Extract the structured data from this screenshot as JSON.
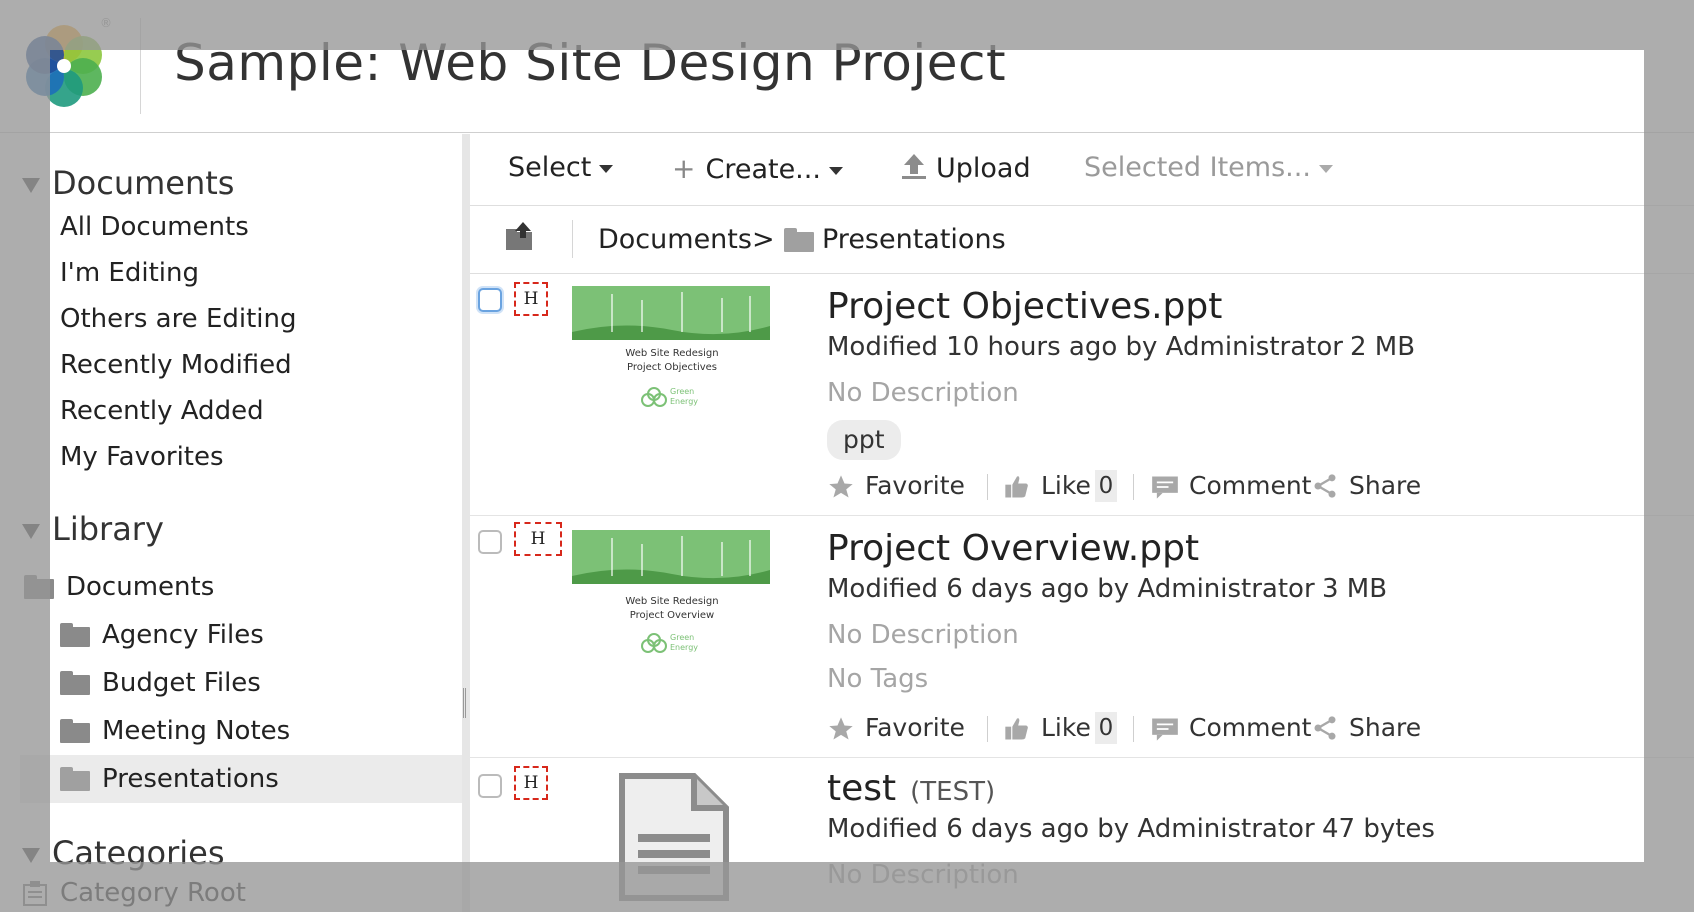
{
  "header": {
    "title": "Sample: Web Site Design Project",
    "logo": "alfresco-flower-logo"
  },
  "sidebar": {
    "documents": {
      "title": "Documents",
      "items": [
        {
          "label": "All Documents"
        },
        {
          "label": "I'm Editing"
        },
        {
          "label": "Others are Editing"
        },
        {
          "label": "Recently Modified"
        },
        {
          "label": "Recently Added"
        },
        {
          "label": "My Favorites"
        }
      ]
    },
    "library": {
      "title": "Library",
      "root": {
        "label": "Documents",
        "icon": "folder-icon"
      },
      "folders": [
        {
          "label": "Agency Files",
          "icon": "folder-icon"
        },
        {
          "label": "Budget Files",
          "icon": "folder-icon"
        },
        {
          "label": "Meeting Notes",
          "icon": "folder-icon"
        },
        {
          "label": "Presentations",
          "icon": "folder-open-icon",
          "selected": true
        }
      ]
    },
    "categories": {
      "title": "Categories",
      "root": {
        "label": "Category Root",
        "icon": "category-icon"
      }
    }
  },
  "toolbar": {
    "select_label": "Select",
    "create_label": "Create...",
    "upload_label": "Upload",
    "selected_items_label": "Selected Items..."
  },
  "breadcrumb": {
    "root": "Documents",
    "separator": ">",
    "current": "Presentations"
  },
  "documents": [
    {
      "name": "Project Objectives.ppt",
      "modified": "Modified 10 hours ago by Administrator",
      "size": "2 MB",
      "description": "No Description",
      "tags": [
        "ppt"
      ],
      "thumbnail": {
        "line1": "Web Site Redesign",
        "line2": "Project Objectives",
        "brand1": "Green",
        "brand2": "Energy"
      },
      "actions": {
        "favorite": "Favorite",
        "like": "Like",
        "like_count": "0",
        "comment": "Comment",
        "share": "Share"
      }
    },
    {
      "name": "Project Overview.ppt",
      "modified": "Modified 6 days ago by Administrator",
      "size": "3 MB",
      "description": "No Description",
      "no_tags": "No Tags",
      "thumbnail": {
        "line1": "Web Site Redesign",
        "line2": "Project Overview",
        "brand1": "Green",
        "brand2": "Energy"
      },
      "actions": {
        "favorite": "Favorite",
        "like": "Like",
        "like_count": "0",
        "comment": "Comment",
        "share": "Share"
      }
    },
    {
      "name": "test",
      "title": "(TEST)",
      "modified": "Modified 6 days ago by Administrator",
      "size": "47 bytes",
      "description": "No Description",
      "thumbnail_icon": "text-document-icon"
    }
  ],
  "badge_letter": "H",
  "colors": {
    "badge_border": "#d7281b",
    "thumb_green": "#5aa84f",
    "overlay": "#969696"
  }
}
